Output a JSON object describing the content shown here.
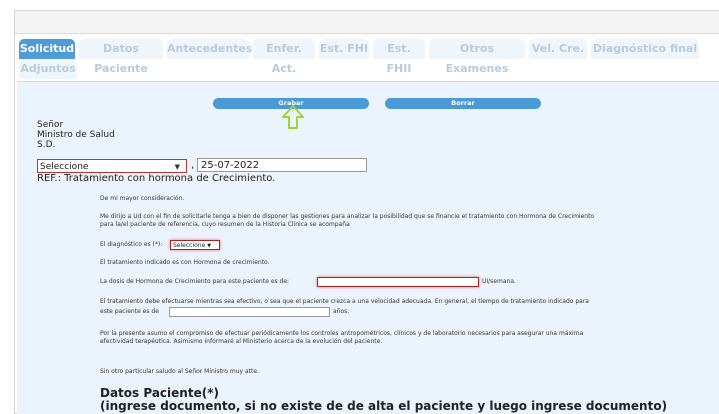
{
  "tabs": [
    {
      "label": "Solicitud",
      "active": true
    },
    {
      "label": "Datos Paciente",
      "active": false
    },
    {
      "label": "Antecedentes",
      "active": false
    },
    {
      "label": "Enfer. Act.",
      "active": false
    },
    {
      "label": "Est. FHI",
      "active": false
    },
    {
      "label": "Est. FHII",
      "active": false
    },
    {
      "label": "Otros Examenes",
      "active": false
    },
    {
      "label": "Vel. Cre.",
      "active": false
    },
    {
      "label": "Diagnóstico final",
      "active": false
    },
    {
      "label": "Adjuntos",
      "active": false
    }
  ],
  "toolbar": {
    "save_label": "Grabar",
    "delete_label": "Borrar"
  },
  "address": {
    "line1": "Señor",
    "line2": "Ministro de Salud",
    "line3": "S.D."
  },
  "form": {
    "location_select": "Seleccione",
    "comma": ",",
    "date": "25-07-2022",
    "ref": "REF.: Tratamiento con hormona de Crecimiento.",
    "greeting": "De mi mayor consideración.",
    "intro_line1": "Me dirijo a Ud con el fin de solicitarle tenga a bien de disponer las gestiones para analizar la posibilidad que se financie el tratamiento con Hormona de Crecimiento",
    "intro_line2": "para la/el paciente de referencia, cuyo resumen de la Historia Clínica se acompaña",
    "diagnosis_label": "El diagnóstico es (*):",
    "diagnosis_select": "Seleccione",
    "treatment_text": "El tratamiento indicado es con Hormona de crecimiento.",
    "dose_label": "La dosis de Hormona de Crecimiento para este paciente es de:",
    "dose_unit": "UI/semana.",
    "duration_line1": "El tratamiento debe efectuarse mientras sea efectivo, o sea que el paciente crezca a una velocidad adecuada. En general, el tiempo de tratamiento indicado para",
    "duration_line2": "este paciente es de",
    "years_unit": "años.",
    "commitment_line1": "Por la presente asumo el compromiso de efectuar periódicamente los controles antropométricos, clínicos y de laboratorio necesarios para asegurar una máxima",
    "commitment_line2": "efectividad terapéutica. Asimismo informaré al Ministerio acerca de la evolución del paciente.",
    "closing": "Sin otro particular saludo al Señor Ministro muy atte.",
    "patient_heading": "Datos Paciente(*)",
    "patient_subheading": "(ingrese documento, si no existe de de alta el paciente y luego ingrese documento)"
  },
  "colors": {
    "tab_active": "#4e9bd8",
    "button": "#4a9ad8",
    "content_bg": "#ebf4fd",
    "arrow": "#9ad633"
  }
}
